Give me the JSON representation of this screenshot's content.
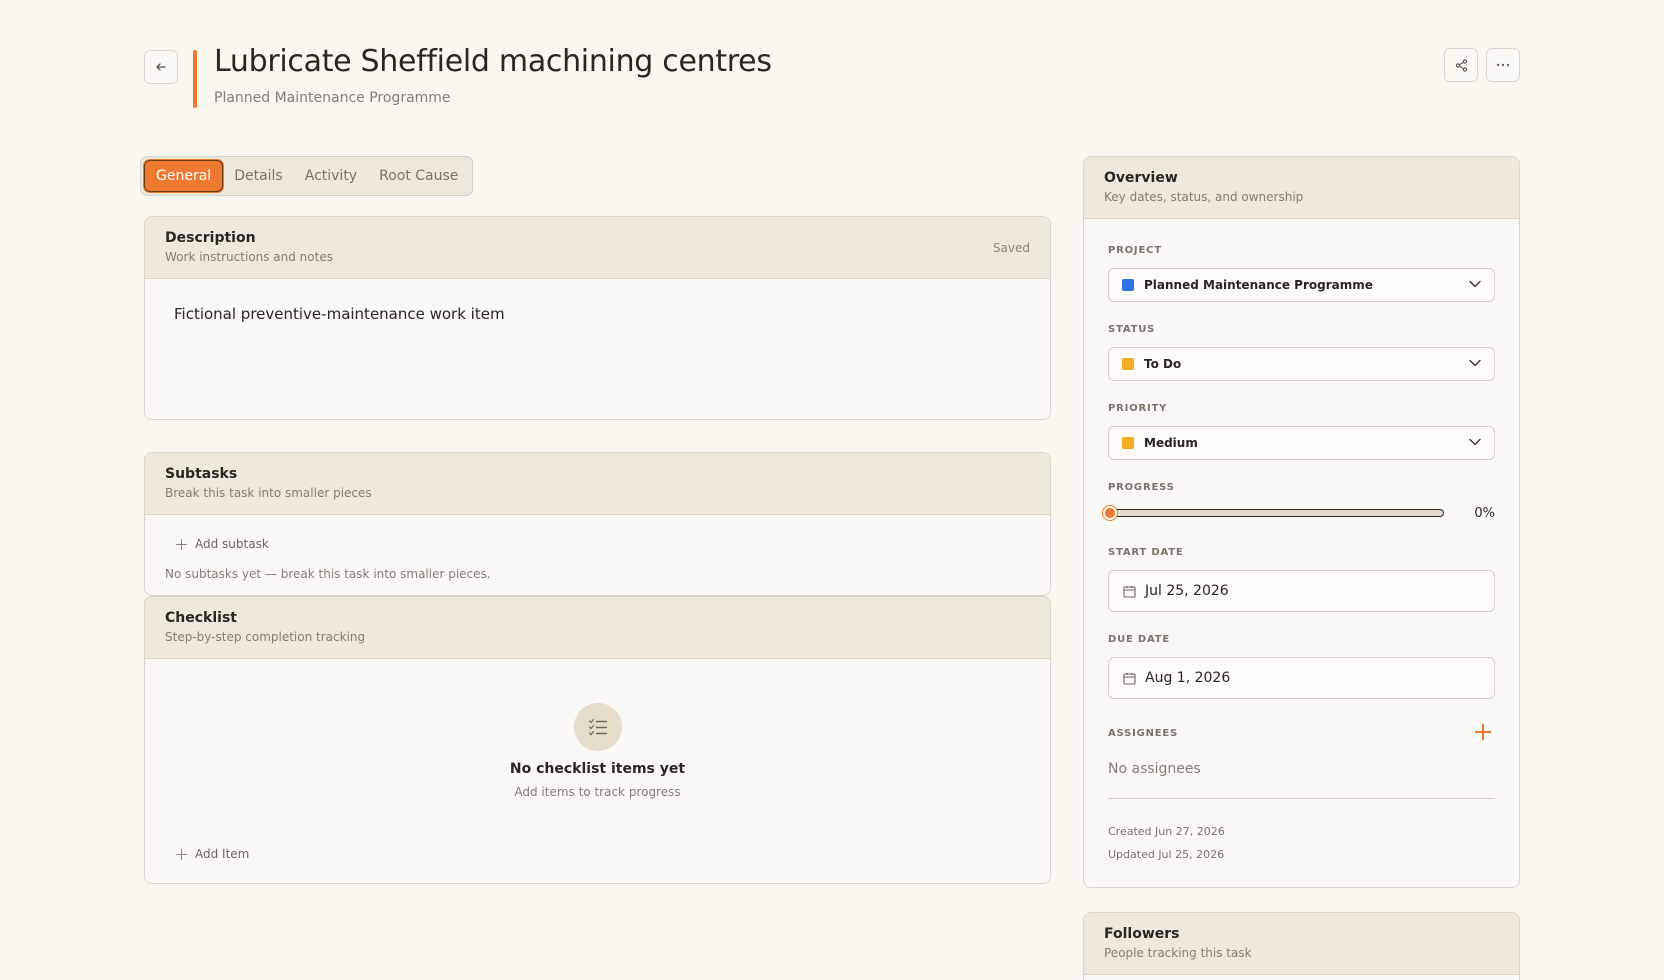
{
  "header": {
    "title": "Lubricate Sheffield machining centres",
    "subtitle": "Planned Maintenance Programme",
    "accent_color": "#ee7a32"
  },
  "tabs": [
    {
      "label": "General",
      "active": true
    },
    {
      "label": "Details",
      "active": false
    },
    {
      "label": "Activity",
      "active": false
    },
    {
      "label": "Root Cause",
      "active": false
    }
  ],
  "description": {
    "title": "Description",
    "subtitle": "Work instructions and notes",
    "status": "Saved",
    "text": "Fictional preventive-maintenance work item"
  },
  "subtasks": {
    "title": "Subtasks",
    "subtitle": "Break this task into smaller pieces",
    "add_label": "Add subtask",
    "empty_note": "No subtasks yet — break this task into smaller pieces."
  },
  "checklist": {
    "title": "Checklist",
    "subtitle": "Step-by-step completion tracking",
    "empty_title": "No checklist items yet",
    "empty_sub": "Add items to track progress",
    "add_label": "Add Item"
  },
  "overview": {
    "title": "Overview",
    "subtitle": "Key dates, status, and ownership",
    "project_label": "PROJECT",
    "project_value": "Planned Maintenance Programme",
    "project_color": "#2c72e8",
    "status_label": "STATUS",
    "status_value": "To Do",
    "status_color": "#f2b01e",
    "priority_label": "PRIORITY",
    "priority_value": "Medium",
    "priority_color": "#f2b01e",
    "progress_label": "PROGRESS",
    "progress_value": 0,
    "progress_text": "0%",
    "start_label": "START DATE",
    "start_value": "Jul 25, 2026",
    "due_label": "DUE DATE",
    "due_value": "Aug 1, 2026",
    "assignees_label": "ASSIGNEES",
    "assignees_empty": "No assignees",
    "created": "Created Jun 27, 2026",
    "updated": "Updated Jul 25, 2026"
  },
  "followers": {
    "title": "Followers",
    "subtitle": "People tracking this task"
  }
}
